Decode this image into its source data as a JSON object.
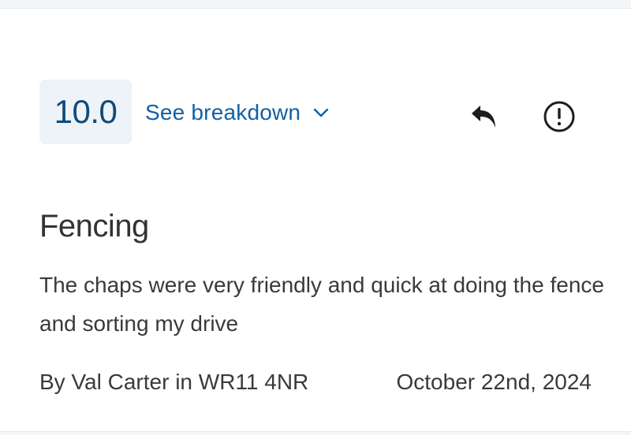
{
  "review": {
    "score": "10.0",
    "breakdown_label": "See breakdown",
    "title": "Fencing",
    "body": "The chaps were very friendly and quick at doing the fence and sorting my drive",
    "author_line": "By Val Carter in WR11 4NR",
    "date": "October 22nd, 2024"
  },
  "icons": {
    "breakdown_toggle": "chevron-down-icon",
    "reply": "reply-icon",
    "report": "report-icon"
  },
  "colors": {
    "score_text": "#104a7c",
    "score_background": "#eef3f7",
    "link": "#1260a3",
    "text": "#333333"
  }
}
